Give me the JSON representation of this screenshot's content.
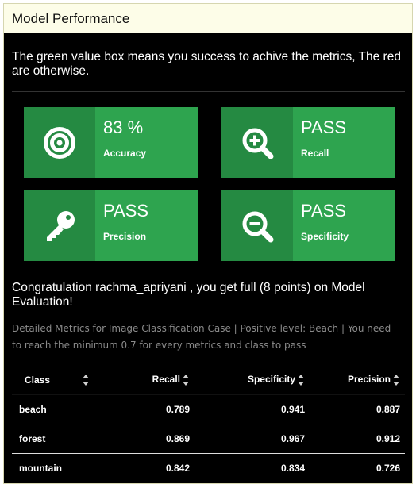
{
  "header": {
    "title": "Model Performance"
  },
  "intro": "The green value box means you success to achive the metrics, The red are otherwise.",
  "value_boxes": [
    {
      "value": "83 %",
      "label": "Accuracy",
      "icon": "bullseye-icon",
      "color": "#2ea44f"
    },
    {
      "value": "PASS",
      "label": "Recall",
      "icon": "search-plus-icon",
      "color": "#2ea44f"
    },
    {
      "value": "PASS",
      "label": "Precision",
      "icon": "key-icon",
      "color": "#2ea44f"
    },
    {
      "value": "PASS",
      "label": "Specificity",
      "icon": "search-minus-icon",
      "color": "#2ea44f"
    }
  ],
  "congrats": "Congratulation rachma_apriyani , you get full (8 points) on Model Evaluation!",
  "details": "Detailed Metrics for Image Classification Case | Positive level: Beach | You need to reach the minimum 0.7 for every metrics and class to pass",
  "table": {
    "columns": [
      "Class",
      "Recall",
      "Specificity",
      "Precision"
    ],
    "rows": [
      {
        "class": "beach",
        "recall": "0.789",
        "specificity": "0.941",
        "precision": "0.887"
      },
      {
        "class": "forest",
        "recall": "0.869",
        "specificity": "0.967",
        "precision": "0.912"
      },
      {
        "class": "mountain",
        "recall": "0.842",
        "specificity": "0.834",
        "precision": "0.726"
      }
    ]
  }
}
